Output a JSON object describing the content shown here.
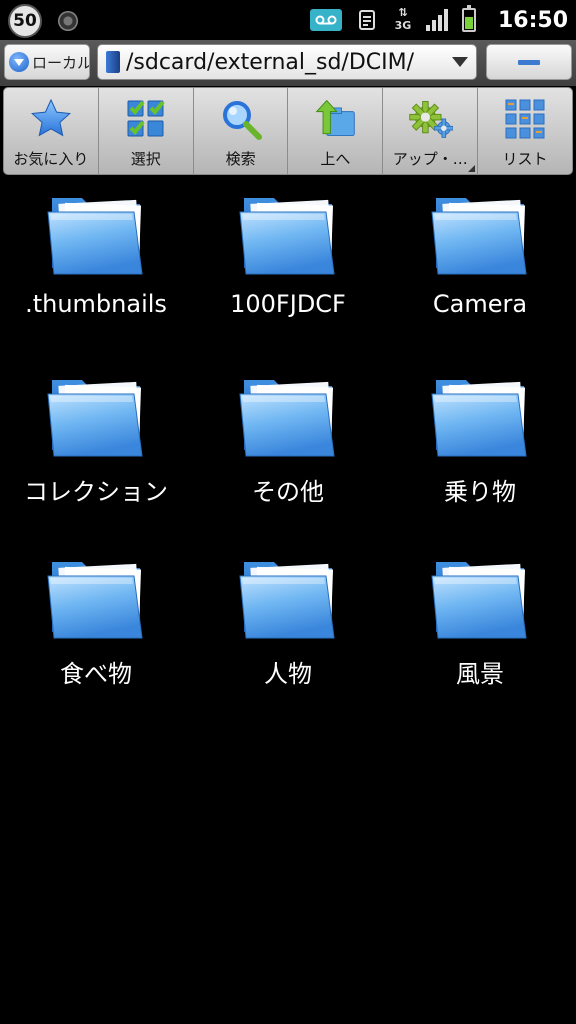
{
  "status_bar": {
    "notification_count": "50",
    "time": "16:50",
    "network": "3G"
  },
  "address_bar": {
    "location_button": "ローカル",
    "path": "/sdcard/external_sd/DCIM/"
  },
  "toolbar": {
    "items": [
      {
        "label": "お気に入り",
        "icon": "star-icon"
      },
      {
        "label": "選択",
        "icon": "checklist-icon"
      },
      {
        "label": "検索",
        "icon": "magnifier-icon"
      },
      {
        "label": "上へ",
        "icon": "up-folder-icon"
      },
      {
        "label": "アップ・…",
        "icon": "gears-icon"
      },
      {
        "label": "リスト",
        "icon": "grid-view-icon"
      }
    ]
  },
  "folders": [
    {
      "name": ".thumbnails"
    },
    {
      "name": "100FJDCF"
    },
    {
      "name": "Camera"
    },
    {
      "name": "コレクション"
    },
    {
      "name": "その他"
    },
    {
      "name": "乗り物"
    },
    {
      "name": "食べ物"
    },
    {
      "name": "人物"
    },
    {
      "name": "風景"
    }
  ],
  "colors": {
    "background": "#000000",
    "folder_blue": "#5aa8e8",
    "accent_blue": "#3f7ad1",
    "voicemail_teal": "#36b3c8",
    "battery_green": "#7ad23a"
  }
}
